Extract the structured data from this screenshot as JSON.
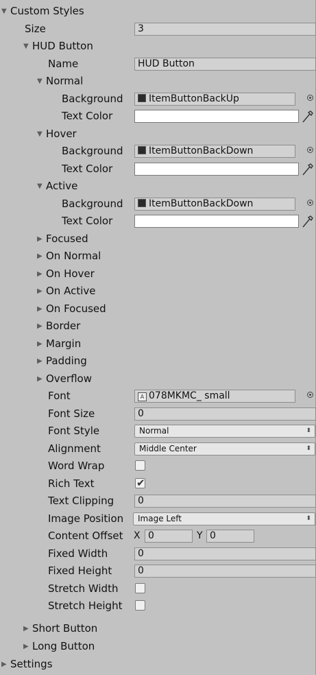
{
  "panel": {
    "custom_styles": "Custom Styles",
    "size_label": "Size",
    "size_value": "3",
    "hud_button": {
      "title": "HUD Button",
      "name_label": "Name",
      "name_value": "HUD Button",
      "normal": {
        "title": "Normal",
        "bg_label": "Background",
        "bg_value": "ItemButtonBackUp",
        "text_color_label": "Text Color"
      },
      "hover": {
        "title": "Hover",
        "bg_label": "Background",
        "bg_value": "ItemButtonBackDown",
        "text_color_label": "Text Color"
      },
      "active": {
        "title": "Active",
        "bg_label": "Background",
        "bg_value": "ItemButtonBackDown",
        "text_color_label": "Text Color"
      },
      "collapsed": [
        "Focused",
        "On Normal",
        "On Hover",
        "On Active",
        "On Focused",
        "Border",
        "Margin",
        "Padding",
        "Overflow"
      ],
      "font_label": "Font",
      "font_value": "078MKMC_ small",
      "font_size_label": "Font Size",
      "font_size_value": "0",
      "font_style_label": "Font Style",
      "font_style_value": "Normal",
      "alignment_label": "Alignment",
      "alignment_value": "Middle Center",
      "word_wrap_label": "Word Wrap",
      "word_wrap_checked": false,
      "rich_text_label": "Rich Text",
      "rich_text_checked": true,
      "text_clipping_label": "Text Clipping",
      "text_clipping_value": "0",
      "image_position_label": "Image Position",
      "image_position_value": "Image Left",
      "content_offset_label": "Content Offset",
      "content_offset_x_label": "X",
      "content_offset_x": "0",
      "content_offset_y_label": "Y",
      "content_offset_y": "0",
      "fixed_width_label": "Fixed Width",
      "fixed_width_value": "0",
      "fixed_height_label": "Fixed Height",
      "fixed_height_value": "0",
      "stretch_width_label": "Stretch Width",
      "stretch_width_checked": false,
      "stretch_height_label": "Stretch Height",
      "stretch_height_checked": false
    },
    "short_button": "Short Button",
    "long_button": "Long Button",
    "settings": "Settings"
  },
  "icons": {
    "expanded": "triangle-down-icon",
    "collapsed": "triangle-right-icon",
    "object_picker": "object-picker-icon",
    "eyedropper": "eyedropper-icon",
    "texture": "texture-icon",
    "font": "font-asset-icon",
    "dropdown": "dropdown-arrow-icon",
    "checkmark": "checkmark-icon"
  }
}
